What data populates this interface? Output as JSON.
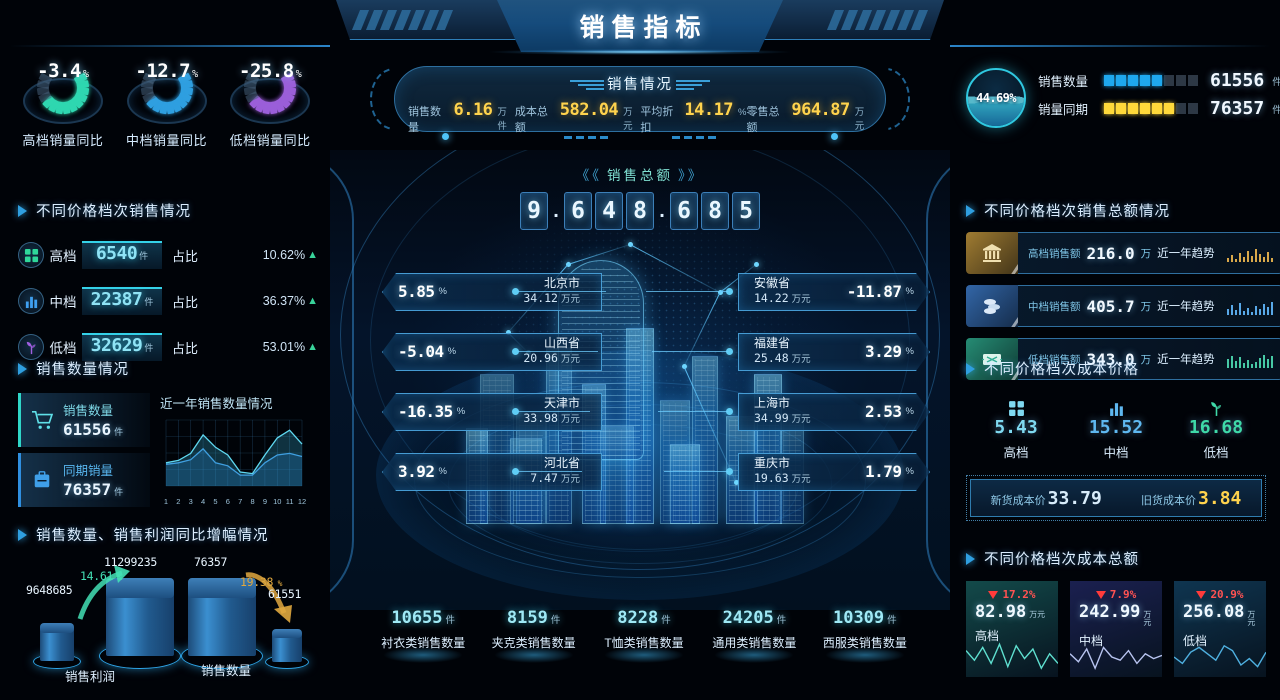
{
  "header": {
    "title": "销售指标"
  },
  "top_gauges": [
    {
      "value": "-3.4",
      "unit": "%",
      "label": "高档销量同比",
      "color": "#2fd7b0"
    },
    {
      "value": "-12.7",
      "unit": "%",
      "label": "中档销量同比",
      "color": "#2f9fe0"
    },
    {
      "value": "-25.8",
      "unit": "%",
      "label": "低档销量同比",
      "color": "#9b5fd9"
    }
  ],
  "left_tier_section": {
    "heading": "不同价格档次销售情况",
    "rows": [
      {
        "icon": "four-squares-icon",
        "name": "高档",
        "value": "6540",
        "unit": "件",
        "ratio_label": "占比",
        "ratio": "10.62%",
        "bar_pct": 10.62,
        "icon_color": "#2fd79a"
      },
      {
        "icon": "bar-chart-icon",
        "name": "中档",
        "value": "22387",
        "unit": "件",
        "ratio_label": "占比",
        "ratio": "36.37%",
        "bar_pct": 36.37,
        "icon_color": "#3f9ff0"
      },
      {
        "icon": "plant-icon",
        "name": "低档",
        "value": "32629",
        "unit": "件",
        "ratio_label": "占比",
        "ratio": "53.01%",
        "bar_pct": 53.01,
        "icon_color": "#a15fe0"
      }
    ]
  },
  "qty_section": {
    "heading": "销售数量情况",
    "cards": [
      {
        "icon": "cart-icon",
        "title": "销售数量",
        "value": "61556",
        "unit": "件"
      },
      {
        "icon": "bag-icon",
        "title": "同期销量",
        "value": "76357",
        "unit": "件"
      }
    ],
    "chart_title": "近一年销售数量情况"
  },
  "growth_section": {
    "heading": "销售数量、销售利润同比增幅情况",
    "groups": [
      {
        "name": "销售利润",
        "from_value": "9648685",
        "to_value": "11299235",
        "change": "14.61",
        "change_unit": "%",
        "direction": "up",
        "color": "#43e0b5"
      },
      {
        "name": "销售数量",
        "from_value": "76357",
        "to_value": "61551",
        "change": "19.38",
        "change_unit": "%",
        "direction": "down",
        "color": "#e0a83f"
      }
    ]
  },
  "center_capsule": {
    "title": "销售情况",
    "stats": [
      {
        "key": "销售数量",
        "value": "6.16",
        "unit": "万件"
      },
      {
        "key": "成本总额",
        "value": "582.04",
        "unit": "万元"
      },
      {
        "key": "平均折扣",
        "value": "14.17",
        "unit": "%"
      },
      {
        "key": "零售总额",
        "value": "964.87",
        "unit": "万元"
      }
    ]
  },
  "total_amount": {
    "title": "销售总额",
    "left_quote": "《《",
    "right_quote": "》》",
    "digits": [
      "9",
      ".",
      "6",
      "4",
      "8",
      ".",
      "6",
      "8",
      "5"
    ]
  },
  "city_tags": {
    "left": [
      {
        "pct": "5.85",
        "unit": "%",
        "city": "北京市",
        "amount": "34.12",
        "amount_unit": "万元"
      },
      {
        "pct": "-5.04",
        "unit": "%",
        "city": "山西省",
        "amount": "20.96",
        "amount_unit": "万元"
      },
      {
        "pct": "-16.35",
        "unit": "%",
        "city": "天津市",
        "amount": "33.98",
        "amount_unit": "万元"
      },
      {
        "pct": "3.92",
        "unit": "%",
        "city": "河北省",
        "amount": "7.47",
        "amount_unit": "万元"
      }
    ],
    "right": [
      {
        "pct": "-11.87",
        "unit": "%",
        "city": "安徽省",
        "amount": "14.22",
        "amount_unit": "万元"
      },
      {
        "pct": "3.29",
        "unit": "%",
        "city": "福建省",
        "amount": "25.48",
        "amount_unit": "万元"
      },
      {
        "pct": "2.53",
        "unit": "%",
        "city": "上海市",
        "amount": "34.99",
        "amount_unit": "万元"
      },
      {
        "pct": "1.79",
        "unit": "%",
        "city": "重庆市",
        "amount": "19.63",
        "amount_unit": "万元"
      }
    ]
  },
  "categories": [
    {
      "value": "10655",
      "unit": "件",
      "label": "衬衣类销售数量"
    },
    {
      "value": "8159",
      "unit": "件",
      "label": "夹克类销售数量"
    },
    {
      "value": "8228",
      "unit": "件",
      "label": "T恤类销售数量"
    },
    {
      "value": "24205",
      "unit": "件",
      "label": "通用类销售数量"
    },
    {
      "value": "10309",
      "unit": "件",
      "label": "西服类销售数量"
    }
  ],
  "right_gauge": {
    "percent": "44.69%",
    "rows": [
      {
        "label": "销售数量",
        "value": "61556",
        "unit": "件",
        "filled": 5,
        "total": 8,
        "color": "#1fa8ee"
      },
      {
        "label": "销量同期",
        "value": "76357",
        "unit": "件",
        "filled": 6,
        "total": 8,
        "color": "#ffd93b"
      }
    ]
  },
  "right_amount_section": {
    "heading": "不同价格档次销售总额情况",
    "rows": [
      {
        "icon": "museum-icon",
        "key": "高档销售额",
        "value": "216.0",
        "unit": "万",
        "trend_label": "近一年趋势",
        "icon_color": "#c89a3c",
        "spark_color": "#d9a84a",
        "spark": [
          4,
          7,
          3,
          9,
          5,
          11,
          6,
          13,
          8,
          5,
          10,
          4
        ]
      },
      {
        "icon": "coins-icon",
        "key": "中档销售额",
        "value": "405.7",
        "unit": "万",
        "trend_label": "近一年趋势",
        "icon_color": "#3f7fd0",
        "spark_color": "#58a8e8",
        "spark": [
          6,
          10,
          5,
          12,
          4,
          7,
          3,
          9,
          6,
          11,
          8,
          13
        ]
      },
      {
        "icon": "ticket-icon",
        "key": "低档销售额",
        "value": "343.0",
        "unit": "万",
        "trend_label": "近一年趋势",
        "icon_color": "#2fae8f",
        "spark_color": "#47c9a5",
        "spark": [
          9,
          12,
          7,
          11,
          5,
          8,
          4,
          6,
          10,
          13,
          9,
          12
        ]
      }
    ]
  },
  "right_cost_section": {
    "heading": "不同价格档次成本价格",
    "items": [
      {
        "icon": "four-squares-icon",
        "value": "5.43",
        "label": "高档",
        "color": "#7fd9f0"
      },
      {
        "icon": "bar-chart-icon",
        "value": "15.52",
        "label": "中档",
        "color": "#5fb8f0"
      },
      {
        "icon": "plant-icon",
        "value": "16.68",
        "label": "低档",
        "color": "#3fd9a8"
      }
    ],
    "strip": [
      {
        "key": "新货成本价",
        "value": "33.79",
        "color": "#d8ecfa"
      },
      {
        "key": "旧货成本价",
        "value": "3.84",
        "color": "#ffd34d"
      }
    ]
  },
  "right_total_section": {
    "heading": "不同价格档次成本总额",
    "cards": [
      {
        "change": "17.2%",
        "direction": "down",
        "value": "82.98",
        "unit": "万元",
        "label": "高档",
        "bg": "#134a4a",
        "line": "#5fe0d0",
        "points": [
          14,
          8,
          16,
          6,
          18,
          4,
          17,
          9,
          15,
          3,
          12,
          6
        ]
      },
      {
        "change": "7.9%",
        "direction": "down",
        "value": "242.99",
        "unit": "万元",
        "label": "中档",
        "bg": "#1b2050",
        "line": "#b8c4f0",
        "points": [
          12,
          7,
          15,
          3,
          16,
          10,
          8,
          14,
          6,
          12,
          9,
          11
        ]
      },
      {
        "change": "20.9%",
        "direction": "down",
        "value": "256.08",
        "unit": "万元",
        "label": "低档",
        "bg": "#0f3550",
        "line": "#4fb0e0",
        "points": [
          10,
          6,
          13,
          16,
          12,
          8,
          17,
          14,
          5,
          9,
          4,
          13
        ]
      }
    ]
  }
}
